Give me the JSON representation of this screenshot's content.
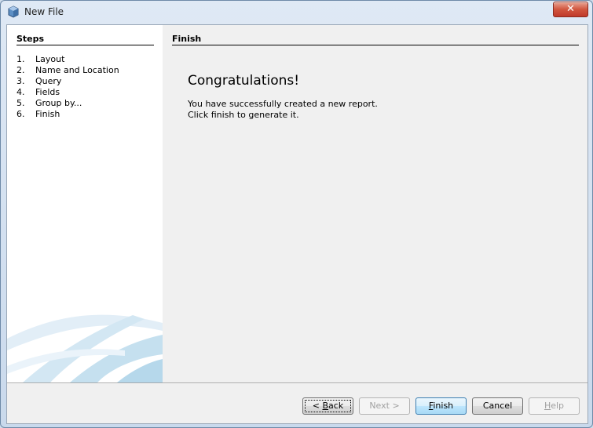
{
  "window": {
    "title": "New File",
    "close_symbol": "✕"
  },
  "steps": {
    "title": "Steps",
    "items": [
      {
        "num": "1.",
        "label": "Layout"
      },
      {
        "num": "2.",
        "label": "Name and Location"
      },
      {
        "num": "3.",
        "label": "Query"
      },
      {
        "num": "4.",
        "label": "Fields"
      },
      {
        "num": "5.",
        "label": "Group by..."
      },
      {
        "num": "6.",
        "label": "Finish"
      }
    ]
  },
  "content": {
    "header": "Finish",
    "heading": "Congratulations!",
    "line1": "You have successfully created a new report.",
    "line2": "Click finish to generate it."
  },
  "buttons": {
    "back": {
      "prefix": "< ",
      "mnemonic": "B",
      "rest": "ack"
    },
    "next": "Next >",
    "finish": {
      "mnemonic": "F",
      "rest": "inish"
    },
    "cancel": "Cancel",
    "help": {
      "mnemonic": "H",
      "rest": "elp"
    }
  },
  "colors": {
    "close_button": "#c0392b",
    "default_button_border": "#3c7fb1",
    "steps_background": "#ffffff"
  }
}
